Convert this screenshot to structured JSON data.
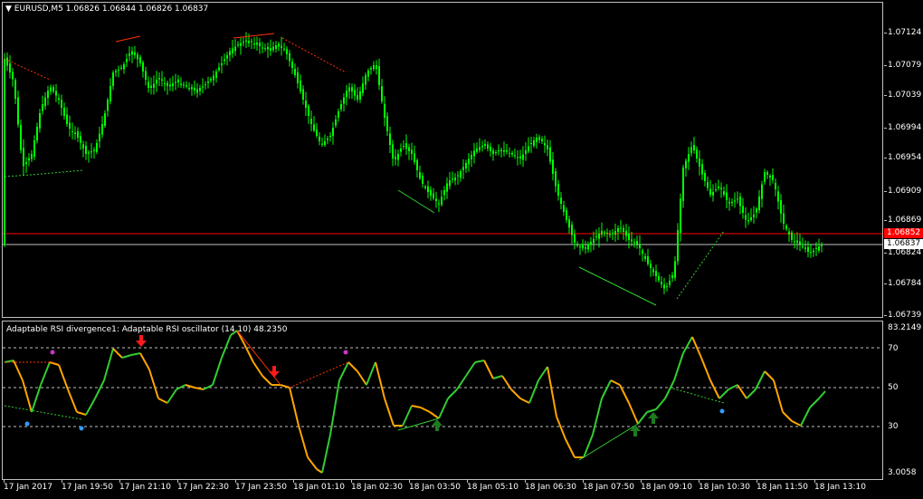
{
  "header": {
    "arrow": "▼",
    "symbol": "EURUSD,M5",
    "ohlc": "1.06826 1.06844 1.06826 1.06837"
  },
  "price_axis": {
    "ticks": [
      "1.07124",
      "1.07079",
      "1.07039",
      "1.06994",
      "1.06954",
      "1.06909",
      "1.06869",
      "1.06824",
      "1.06784",
      "1.06739"
    ],
    "current_bid": "1.06837",
    "red_line_label": "1.06852"
  },
  "indicator": {
    "title": "Adaptable RSI divergence1: Adaptable RSI oscillator (14,10) 48.2350",
    "axis_ticks": [
      "83.2149",
      "70",
      "50",
      "30",
      "3.0058"
    ]
  },
  "time_axis": [
    "17 Jan 2017",
    "17 Jan 19:50",
    "17 Jan 21:10",
    "17 Jan 22:30",
    "17 Jan 23:50",
    "18 Jan 01:10",
    "18 Jan 02:30",
    "18 Jan 03:50",
    "18 Jan 05:10",
    "18 Jan 06:30",
    "18 Jan 07:50",
    "18 Jan 09:10",
    "18 Jan 10:30",
    "18 Jan 11:50",
    "18 Jan 13:10"
  ],
  "colors": {
    "bull_candle": "#00ff00",
    "bear_candle": "#00ff00",
    "oscillator_up": "#32cd32",
    "oscillator_down": "#ffa500",
    "bearish_div": "#ff3300",
    "bullish_div": "#32cd32",
    "red_line": "#ff0000",
    "bid_line": "#c0c0c0",
    "sell_arrow": "#ff1a1a",
    "buy_arrow": "#1f7a1f",
    "magenta_dot": "#cc33cc",
    "blue_dot": "#3399ff"
  },
  "icons": {
    "sell_arrow": "down-arrow-icon",
    "buy_arrow": "up-arrow-icon"
  }
}
